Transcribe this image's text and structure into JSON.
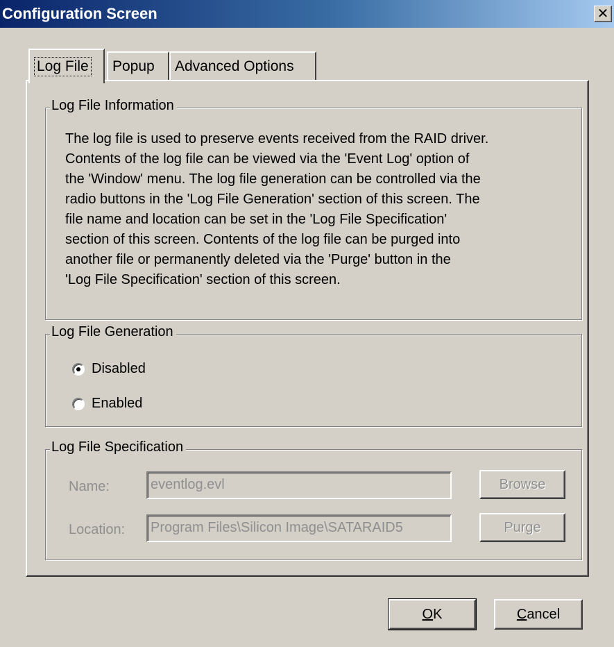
{
  "window": {
    "title": "Configuration Screen",
    "close_glyph": "✕"
  },
  "tabs": [
    {
      "label": "Log File",
      "active": true
    },
    {
      "label": "Popup",
      "active": false
    },
    {
      "label": "Advanced Options",
      "active": false
    }
  ],
  "info_group": {
    "title": "Log File Information",
    "lines": [
      "The log file is used to preserve events received from the RAID driver.",
      "Contents of the log file can be viewed via the 'Event Log' option of",
      "the 'Window' menu. The log file generation can be controlled via the",
      "radio buttons in the 'Log File Generation' section of this screen. The",
      "file name and location can be set  in  the  'Log File Specification'",
      "section of this screen.  Contents of the log file can be purged into",
      "another  file  or  permanently deleted via the 'Purge' button in the",
      "'Log File Specification' section of this screen."
    ]
  },
  "generation_group": {
    "title": "Log File Generation",
    "options": [
      {
        "label": "Disabled",
        "checked": true
      },
      {
        "label": "Enabled",
        "checked": false
      }
    ]
  },
  "spec_group": {
    "title": "Log File Specification",
    "name_label": "Name:",
    "name_value": "eventlog.evl",
    "location_label": "Location:",
    "location_value": "Program Files\\Silicon Image\\SATARAID5",
    "browse_label": "Browse",
    "purge_label": "Purge"
  },
  "footer": {
    "ok_mnemonic": "O",
    "ok_rest": "K",
    "cancel_mnemonic": "C",
    "cancel_rest": "ancel"
  },
  "colors": {
    "face": "#d4d0c8",
    "title_start": "#0a246a",
    "title_end": "#a6caf0",
    "disabled_text": "#8f8f8f"
  }
}
